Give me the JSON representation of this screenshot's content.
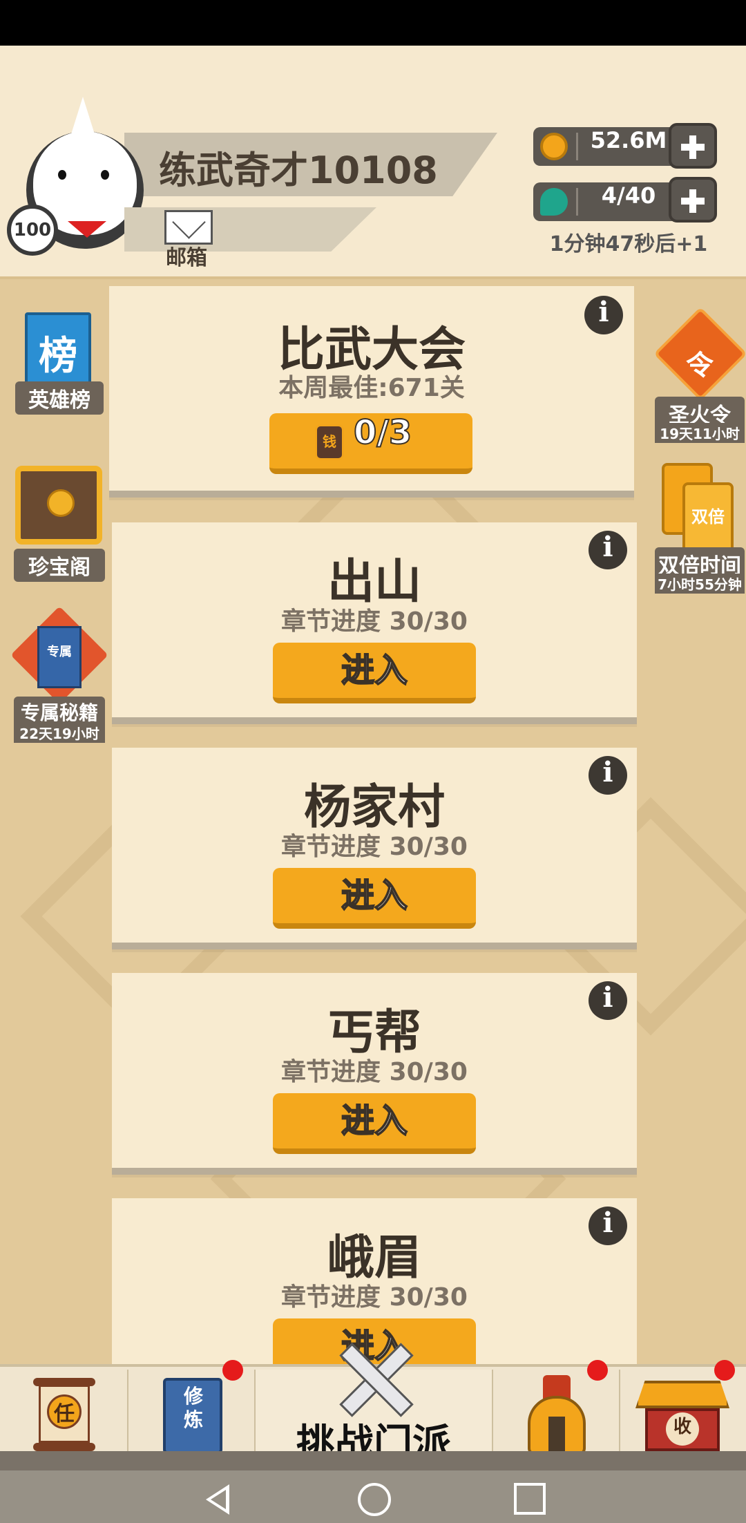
{
  "player": {
    "name": "练武奇才10108",
    "level": "100",
    "mail_label": "邮箱"
  },
  "resources": {
    "coins": "52.6M",
    "stamina": "4/40",
    "regen_timer": "1分钟47秒后+1"
  },
  "left_menu": [
    {
      "label": "英雄榜",
      "icon_text": "榜"
    },
    {
      "label": "珍宝阁"
    },
    {
      "label": "专属秘籍",
      "icon_text": "专属",
      "sub": "22天19小时"
    }
  ],
  "right_menu": [
    {
      "label": "圣火令",
      "icon_text": "令",
      "sub": "19天11小时"
    },
    {
      "label": "双倍时间",
      "icon_text": "双倍",
      "sub": "7小时55分钟"
    }
  ],
  "tournament": {
    "title": "比武大会",
    "best": "本周最佳:671关",
    "ticket_icon_text": "钱",
    "tickets": "0/3"
  },
  "stages": [
    {
      "title": "出山",
      "progress": "章节进度 30/30",
      "button": "进入"
    },
    {
      "title": "杨家村",
      "progress": "章节进度 30/30",
      "button": "进入"
    },
    {
      "title": "丐帮",
      "progress": "章节进度 30/30",
      "button": "进入"
    },
    {
      "title": "峨眉",
      "progress": "章节进度 30/30",
      "button": "进入"
    }
  ],
  "nav": {
    "task_icon_text": "任",
    "train_icon_text": "修炼",
    "challenge_label": "挑战门派",
    "collect_icon_text": "收"
  },
  "info_glyph": "i",
  "colors": {
    "accent": "#f4a81d",
    "card_bg": "#f8ebd0",
    "badge_red": "#e51b1b"
  }
}
